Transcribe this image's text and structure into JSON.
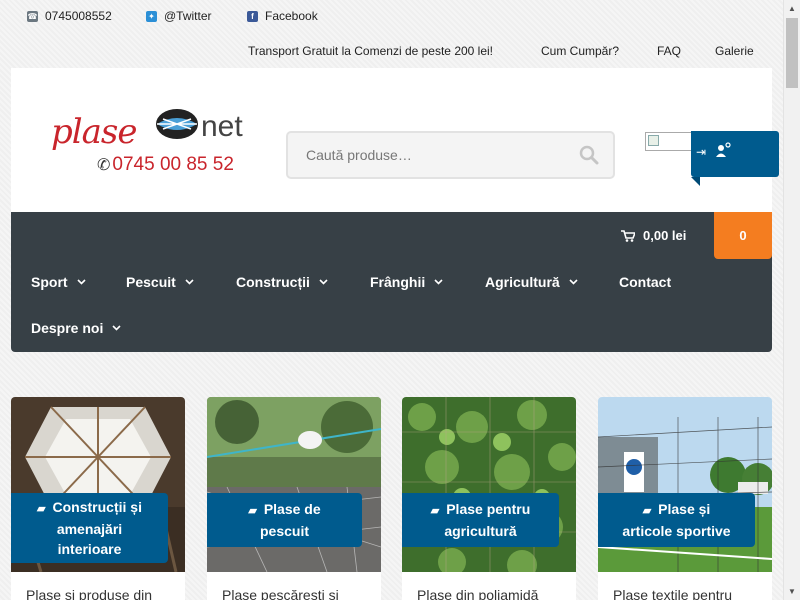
{
  "topbar": {
    "phone": "0745008552",
    "twitter": "@Twitter",
    "facebook": "Facebook",
    "links": [
      "Transport Gratuit la Comenzi de peste 200 lei!",
      "Cum Cumpăr?",
      "FAQ",
      "Galerie"
    ]
  },
  "logo": {
    "word": "plase",
    "net": "net",
    "phone": "0745 00 85 52"
  },
  "search": {
    "placeholder": "Caută produse…"
  },
  "cart": {
    "total": "0,00 lei",
    "count": "0"
  },
  "menu": [
    "Sport",
    "Pescuit",
    "Construcții",
    "Frânghii",
    "Agricultură",
    "Contact",
    "Despre noi"
  ],
  "cards": [
    {
      "label_line1": "Construcții și",
      "label_line2": "amenajări",
      "label_line3": "interioare",
      "desc": "Plase și produse din"
    },
    {
      "label_line1": "Plase de",
      "label_line2": "pescuit",
      "desc": "Plase pescărești și"
    },
    {
      "label_line1": "Plase pentru",
      "label_line2": "agricultură",
      "desc": "Plase din poliamidă"
    },
    {
      "label_line1": "Plase și",
      "label_line2": "articole sportive",
      "desc": "Plase textile pentru"
    }
  ],
  "colors": {
    "accent": "#005b8e",
    "nav": "#374046",
    "cart": "#f47d20",
    "brand": "#c9252c"
  },
  "icons": [
    "phone-icon",
    "twitter-icon",
    "facebook-icon",
    "search-icon",
    "login-icon",
    "user-add-icon",
    "cart-icon",
    "chevron-down-icon",
    "folder-open-icon"
  ]
}
